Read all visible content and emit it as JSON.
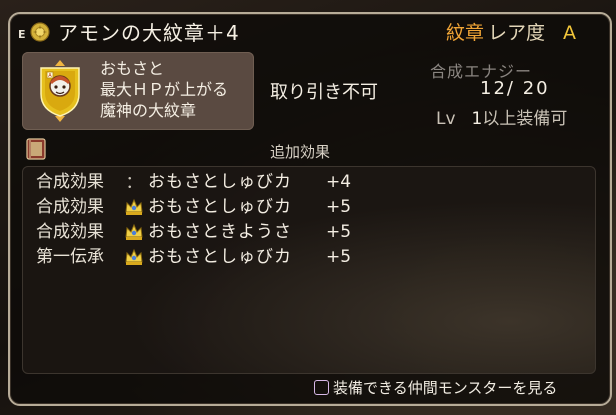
{
  "header": {
    "equip_mark": "E",
    "icon": "emblem-coin-icon",
    "title": "アモンの大紋章＋4"
  },
  "rarity": {
    "kind": "紋章",
    "label": "レア度",
    "grade": "A"
  },
  "info": {
    "crest_icon": "monster-crest-icon",
    "description": [
      "おもさと",
      "最大ＨＰが上がる",
      "魔神の大紋章"
    ],
    "trade": "取り引き不可",
    "energy_label": "合成エナジー",
    "energy_value": "12/ 20",
    "level_label": "Lv",
    "level_value": "1",
    "level_suffix": "以上装備可"
  },
  "effects": {
    "section_title": "追加効果",
    "book_icon": "book-icon",
    "rows": [
      {
        "type": "合成効果",
        "mark": "：",
        "name": "おもさとしゅびカ",
        "value": "+4"
      },
      {
        "type": "合成効果",
        "mark": "crown-icon",
        "name": "おもさとしゅびカ",
        "value": "+5"
      },
      {
        "type": "合成効果",
        "mark": "crown-icon",
        "name": "おもさときようさ",
        "value": "+5"
      },
      {
        "type": "第一伝承",
        "mark": "crown-icon",
        "name": "おもさとしゅびカ",
        "value": "+5"
      }
    ]
  },
  "footer": {
    "button_icon": "square-button-icon",
    "label": "装備できる仲間モンスターを見る"
  },
  "colors": {
    "panel": "#5a4a41",
    "rarity_kind": "#f0a536",
    "grade": "#f1c53a",
    "text": "#f4eee3",
    "frame": "#b7ac98"
  }
}
